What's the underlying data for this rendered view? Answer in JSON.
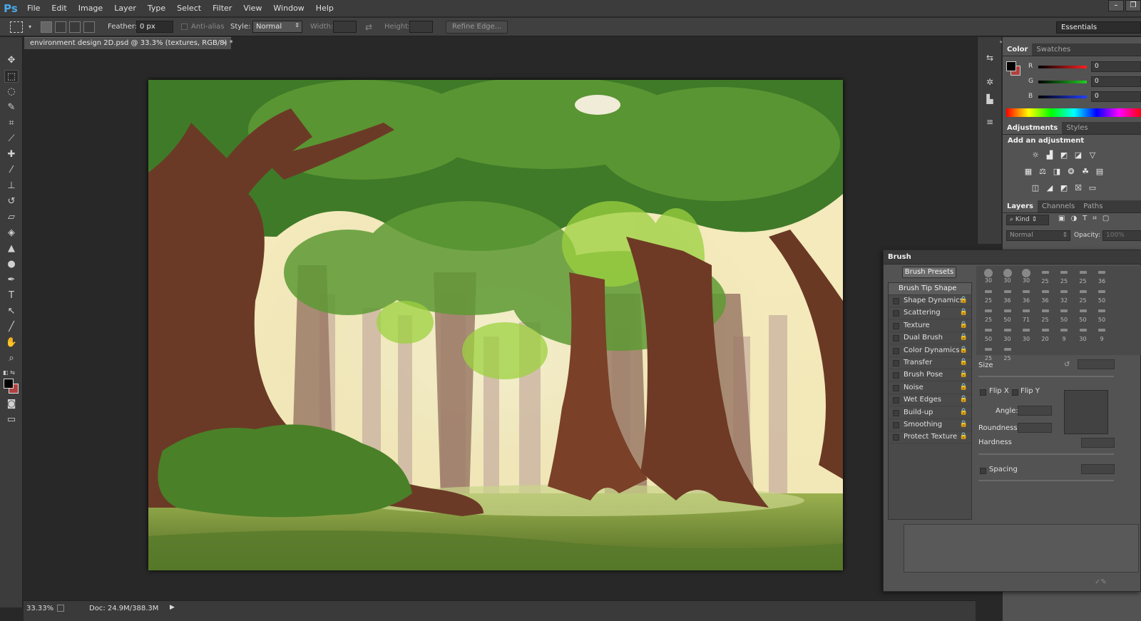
{
  "app": {
    "logo": "Ps"
  },
  "menu": [
    "File",
    "Edit",
    "Image",
    "Layer",
    "Type",
    "Select",
    "Filter",
    "View",
    "Window",
    "Help"
  ],
  "options": {
    "feather_label": "Feather:",
    "feather_value": "0 px",
    "antialias_label": "Anti-alias",
    "style_label": "Style:",
    "style_value": "Normal",
    "width_label": "Width:",
    "height_label": "Height:",
    "refine_edge": "Refine Edge..."
  },
  "workspace": "Essentials",
  "document": {
    "tab_title": "environment design 2D.psd @ 33.3% (textures, RGB/8) *",
    "zoom": "33.33%",
    "doc_size": "Doc: 24.9M/388.3M"
  },
  "color_panel": {
    "tabs": [
      "Color",
      "Swatches"
    ],
    "r_label": "R",
    "g_label": "G",
    "b_label": "B",
    "r": "0",
    "g": "0",
    "b": "0"
  },
  "adjustments_panel": {
    "tabs": [
      "Adjustments",
      "Styles"
    ],
    "heading": "Add an adjustment"
  },
  "layers_panel": {
    "tabs": [
      "Layers",
      "Channels",
      "Paths"
    ],
    "kind": "Kind",
    "blend_mode": "Normal",
    "opacity_label": "Opacity:",
    "opacity_value": "100%"
  },
  "brush_panel": {
    "title": "Brush",
    "presets_button": "Brush Presets",
    "tip_shape": "Brush Tip Shape",
    "options": [
      "Shape Dynamics",
      "Scattering",
      "Texture",
      "Dual Brush",
      "Color Dynamics",
      "Transfer",
      "Brush Pose",
      "Noise",
      "Wet Edges",
      "Build-up",
      "Smoothing",
      "Protect Texture"
    ],
    "tip_sizes": [
      "30",
      "30",
      "30",
      "25",
      "25",
      "25",
      "36",
      "25",
      "36",
      "36",
      "36",
      "32",
      "25",
      "50",
      "25",
      "50",
      "71",
      "25",
      "50",
      "50",
      "50",
      "50",
      "30",
      "30",
      "20",
      "9",
      "30",
      "9",
      "25",
      "25"
    ],
    "size_label": "Size",
    "flip_x": "Flip X",
    "flip_y": "Flip Y",
    "angle_label": "Angle:",
    "roundness_label": "Roundness:",
    "hardness_label": "Hardness",
    "spacing_label": "Spacing"
  },
  "colors": {
    "foreground": "#000000",
    "background": "#b04040",
    "accent": "#4aa8e8"
  }
}
